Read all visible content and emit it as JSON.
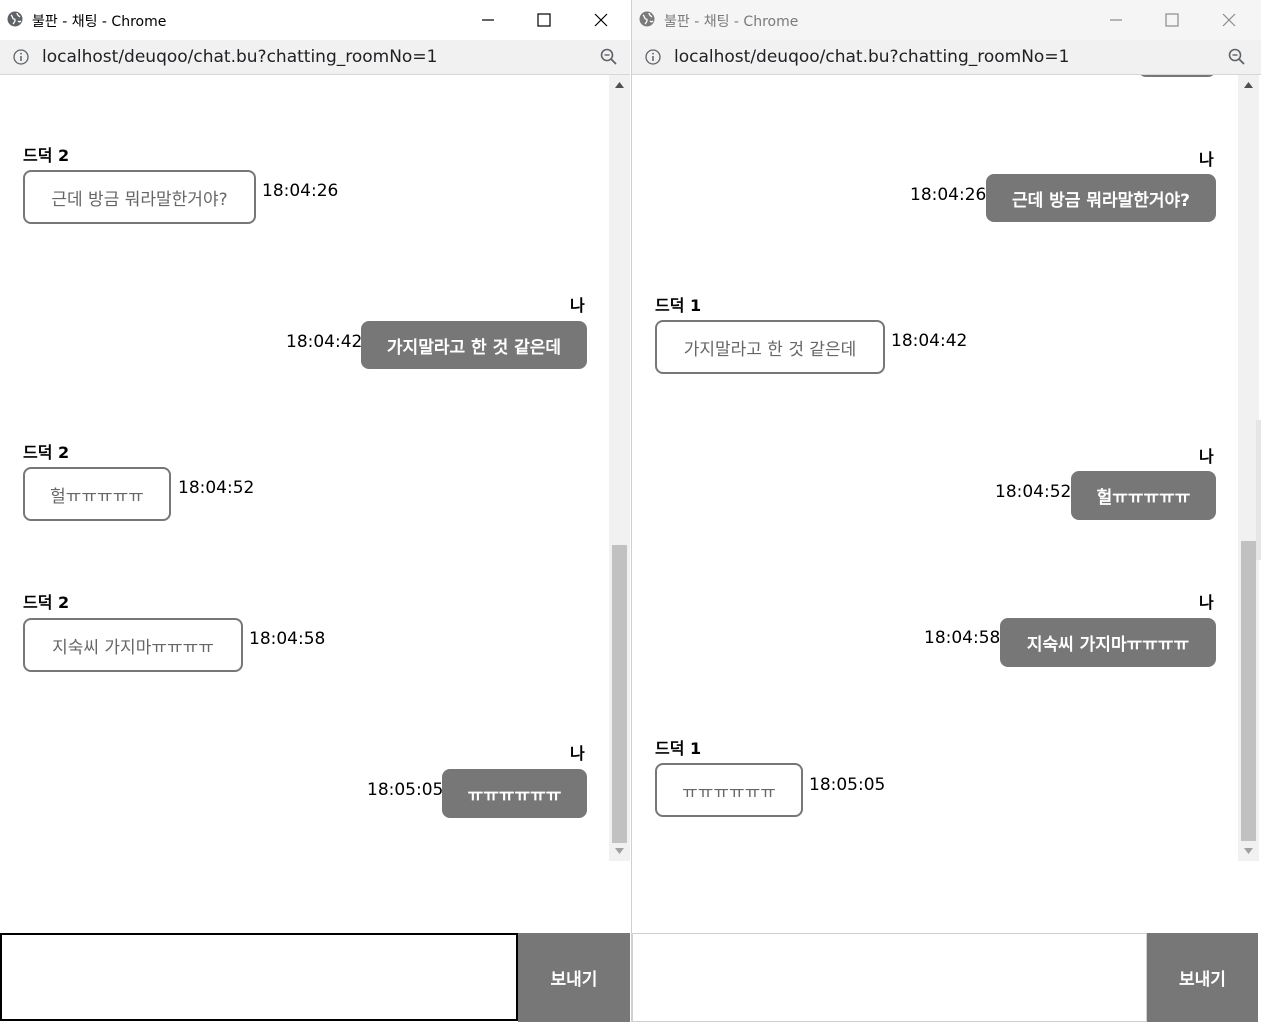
{
  "windows": [
    {
      "title": "불판 - 채팅 - Chrome",
      "url_host": "localhost",
      "url_path": "/deuqoo/chat.bu?chatting_roomNo=1",
      "messages": [
        {
          "sender": "드덕 2",
          "text": "근데 방금 뭐라말한거야?",
          "time": "18:04:26"
        },
        {
          "sender": "나",
          "text": "가지말라고 한 것 같은데",
          "time": "18:04:42"
        },
        {
          "sender": "드덕 2",
          "text": "헐ㅠㅠㅠㅠㅠ",
          "time": "18:04:52"
        },
        {
          "sender": "드덕 2",
          "text": "지숙씨 가지마ㅠㅠㅠㅠ",
          "time": "18:04:58"
        },
        {
          "sender": "나",
          "text": "ㅠㅠㅠㅠㅠㅠ",
          "time": "18:05:05"
        }
      ],
      "input_value": "",
      "send_label": "보내기"
    },
    {
      "title": "불판 - 채팅 - Chrome",
      "url_host": "localhost",
      "url_path": "/deuqoo/chat.bu?chatting_roomNo=1",
      "messages": [
        {
          "sender": "나",
          "text": "근데 방금 뭐라말한거야?",
          "time": "18:04:26"
        },
        {
          "sender": "드덕 1",
          "text": "가지말라고 한 것 같은데",
          "time": "18:04:42"
        },
        {
          "sender": "나",
          "text": "헐ㅠㅠㅠㅠㅠ",
          "time": "18:04:52"
        },
        {
          "sender": "나",
          "text": "지숙씨 가지마ㅠㅠㅠㅠ",
          "time": "18:04:58"
        },
        {
          "sender": "드덕 1",
          "text": "ㅠㅠㅠㅠㅠㅠ",
          "time": "18:05:05"
        }
      ],
      "input_value": "",
      "send_label": "보내기"
    }
  ]
}
